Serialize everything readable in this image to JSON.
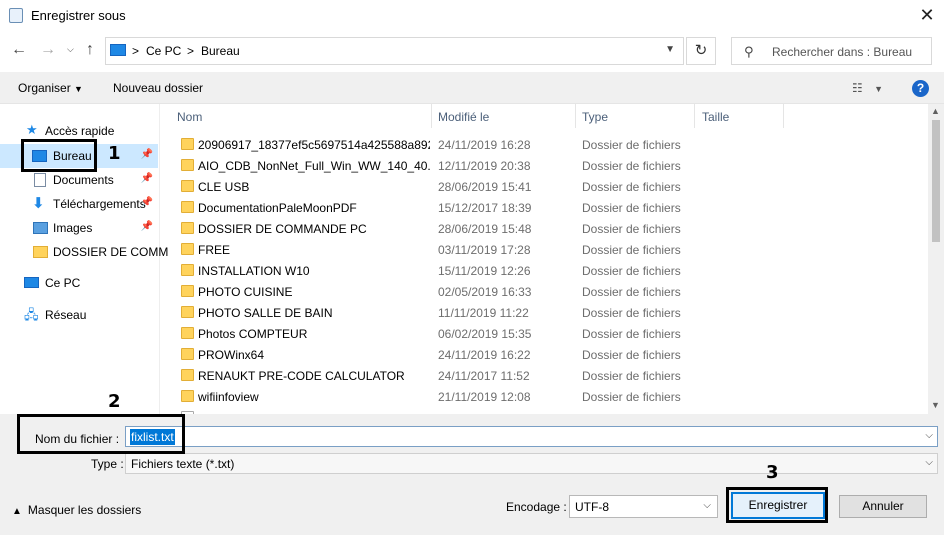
{
  "window": {
    "title": "Enregistrer sous"
  },
  "nav": {
    "path": [
      "Ce PC",
      "Bureau"
    ],
    "separator": ">",
    "search_placeholder": "Rechercher dans : Bureau"
  },
  "toolbar": {
    "organize_label": "Organiser",
    "new_folder_label": "Nouveau dossier"
  },
  "sidebar": {
    "items": [
      {
        "label": "Accès rapide",
        "icon": "star-icon"
      },
      {
        "label": "Bureau",
        "icon": "desktop-icon",
        "selected": true
      },
      {
        "label": "Documents",
        "icon": "document-icon"
      },
      {
        "label": "Téléchargements",
        "icon": "download-icon"
      },
      {
        "label": "Images",
        "icon": "image-icon"
      },
      {
        "label": "DOSSIER DE COMM",
        "icon": "folder-icon"
      },
      {
        "label": "Ce PC",
        "icon": "pc-icon"
      },
      {
        "label": "Réseau",
        "icon": "network-icon"
      }
    ]
  },
  "columns": {
    "name": "Nom",
    "modified": "Modifié le",
    "type": "Type",
    "size": "Taille"
  },
  "files": [
    {
      "name": "20906917_18377ef5c5697514a425588a892f...",
      "date": "24/11/2019 16:28",
      "type": "Dossier de fichiers"
    },
    {
      "name": "AIO_CDB_NonNet_Full_Win_WW_140_40...",
      "date": "12/11/2019 20:38",
      "type": "Dossier de fichiers"
    },
    {
      "name": "CLE USB",
      "date": "28/06/2019 15:41",
      "type": "Dossier de fichiers"
    },
    {
      "name": "DocumentationPaleMoonPDF",
      "date": "15/12/2017 18:39",
      "type": "Dossier de fichiers"
    },
    {
      "name": "DOSSIER DE COMMANDE PC",
      "date": "28/06/2019 15:48",
      "type": "Dossier de fichiers"
    },
    {
      "name": "FREE",
      "date": "03/11/2019 17:28",
      "type": "Dossier de fichiers"
    },
    {
      "name": "INSTALLATION W10",
      "date": "15/11/2019 12:26",
      "type": "Dossier de fichiers"
    },
    {
      "name": "PHOTO CUISINE",
      "date": "02/05/2019 16:33",
      "type": "Dossier de fichiers"
    },
    {
      "name": "PHOTO SALLE DE BAIN",
      "date": "11/11/2019 11:22",
      "type": "Dossier de fichiers"
    },
    {
      "name": "Photos COMPTEUR",
      "date": "06/02/2019 15:35",
      "type": "Dossier de fichiers"
    },
    {
      "name": "PROWinx64",
      "date": "24/11/2019 16:22",
      "type": "Dossier de fichiers"
    },
    {
      "name": "RENAUKT PRE-CODE CALCULATOR",
      "date": "24/11/2017 11:52",
      "type": "Dossier de fichiers"
    },
    {
      "name": "wifiinfoview",
      "date": "21/11/2019 12:08",
      "type": "Dossier de fichiers"
    }
  ],
  "form": {
    "filename_label": "Nom du fichier :",
    "filename_value": "fixlist.txt",
    "type_label": "Type :",
    "type_value": "Fichiers texte (*.txt)",
    "encoding_label": "Encodage :",
    "encoding_value": "UTF-8",
    "hide_folders_label": "Masquer les dossiers",
    "save_label": "Enregistrer",
    "cancel_label": "Annuler"
  },
  "annotations": [
    "1",
    "2",
    "3"
  ],
  "colors": {
    "selection": "#cce8ff",
    "accent": "#0078d7",
    "folder": "#ffd35c"
  }
}
